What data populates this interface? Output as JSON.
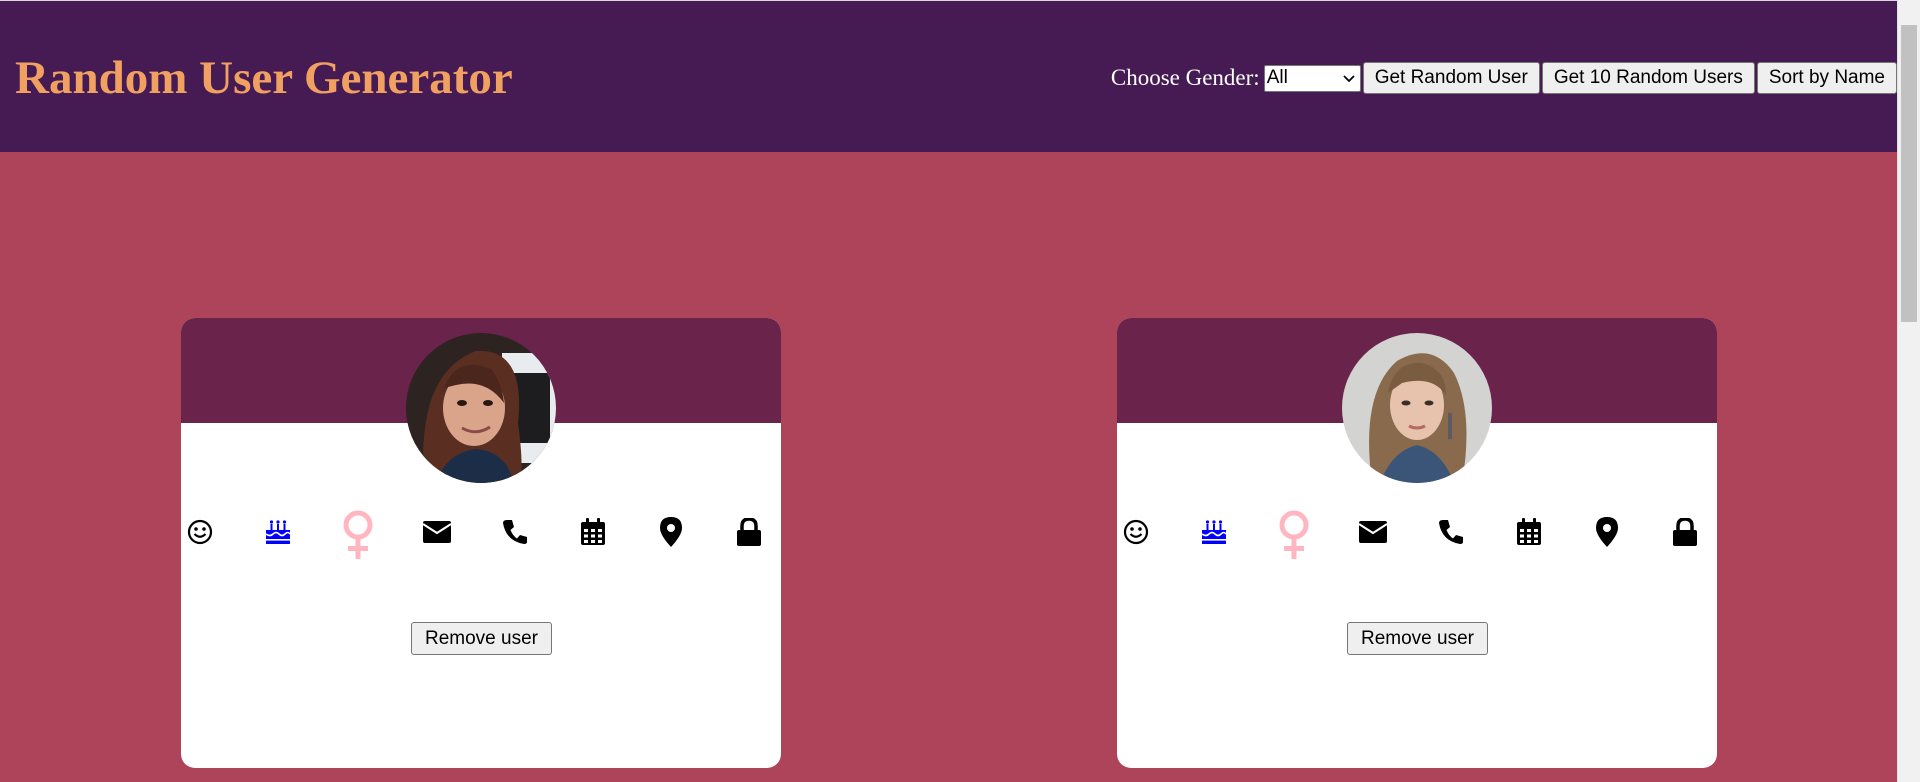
{
  "header": {
    "title": "Random User Generator",
    "gender_label": "Choose Gender:",
    "gender_selected": "All",
    "buttons": {
      "random_user": "Get Random User",
      "ten_users": "Get 10 Random Users",
      "sort": "Sort by Name"
    }
  },
  "cards": [
    {
      "remove_label": "Remove user",
      "icons": [
        "smile-icon",
        "birthday-cake-icon",
        "female-gender-icon",
        "envelope-icon",
        "phone-icon",
        "calendar-icon",
        "map-marker-icon",
        "lock-icon"
      ]
    },
    {
      "remove_label": "Remove user",
      "icons": [
        "smile-icon",
        "birthday-cake-icon",
        "female-gender-icon",
        "envelope-icon",
        "phone-icon",
        "calendar-icon",
        "map-marker-icon",
        "lock-icon"
      ]
    }
  ],
  "colors": {
    "header_bg": "#461b53",
    "page_bg": "#ad4459",
    "title": "#f0a060",
    "card_banner": "#6a234b",
    "cake_icon": "#0000ff",
    "gender_icon": "#ffb6c1"
  }
}
